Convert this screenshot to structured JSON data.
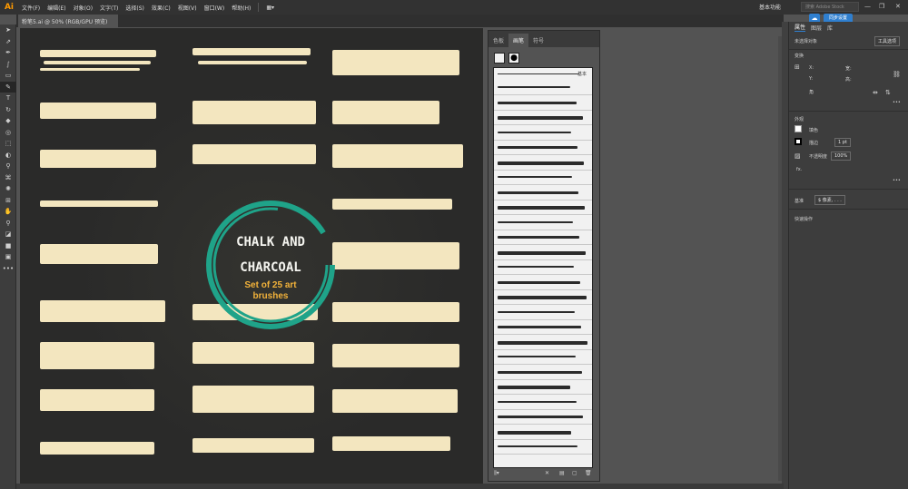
{
  "menubar": {
    "logo": "Ai",
    "items": [
      "文件(F)",
      "编辑(E)",
      "对象(O)",
      "文字(T)",
      "选择(S)",
      "效果(C)",
      "视图(V)",
      "窗口(W)",
      "帮助(H)"
    ],
    "workspace": "基本功能",
    "search_placeholder": "搜索 Adobe Stock",
    "tooltip": "同步设置",
    "minimize": "—",
    "restore": "❐",
    "close": "✕"
  },
  "document": {
    "tab": "粉笔5.ai @ 50% (RGB/GPU 预览)"
  },
  "artwork": {
    "title_line1": "CHALK AND",
    "title_line2": "CHARCOAL",
    "subtitle_line1": "Set of 25 art",
    "subtitle_line2": "brushes"
  },
  "brushes_panel": {
    "tabs": [
      "色板",
      "画笔",
      "符号"
    ],
    "active_tab": "画笔",
    "basic_label": "基本",
    "footer_icons": [
      "brush-library-icon",
      "new-brush-icon",
      "delete-icon"
    ]
  },
  "properties_panel": {
    "tabs": [
      "属性",
      "图层",
      "库"
    ],
    "no_selection": "未选择对象",
    "tool_options": "工具选项",
    "transform_label": "变换",
    "x_label": "X:",
    "y_label": "Y:",
    "w_label": "宽:",
    "h_label": "高:",
    "angle_label": "角",
    "appearance_label": "外观",
    "fill_label": "填色",
    "stroke_label": "描边",
    "stroke_value": "1 pt",
    "opacity_label": "不透明度",
    "opacity_value": "100%",
    "fx_label": "fx.",
    "more_label": "•••",
    "align_label": "基准",
    "unit_value": "$ 像素, . . .",
    "quick_actions": "快速操作"
  },
  "colors": {
    "ring": "#1fa389",
    "chalk": "#f3e6bf",
    "subtitle": "#f2b23a"
  }
}
